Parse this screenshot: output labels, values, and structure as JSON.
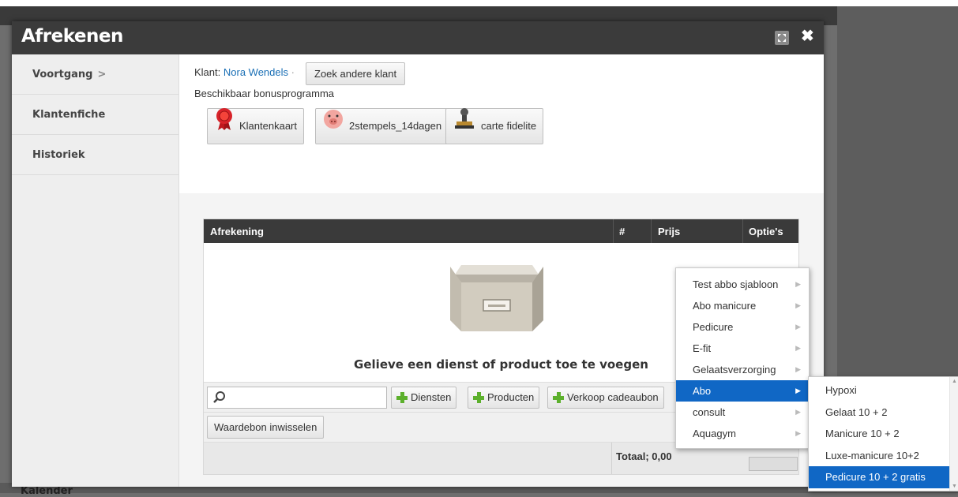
{
  "background": {
    "bottom_label": "Kalender"
  },
  "modal": {
    "title": "Afrekenen"
  },
  "sidebar": {
    "items": [
      {
        "label": "Voortgang",
        "suffix": ">"
      },
      {
        "label": "Klantenfiche"
      },
      {
        "label": "Historiek"
      }
    ]
  },
  "client": {
    "prefix": "Klant:",
    "name": "Nora Wendels",
    "separator": "·",
    "search_button": "Zoek andere klant",
    "bonus_label": "Beschikbaar bonusprogramma",
    "bonus_buttons": [
      {
        "label": "Klantenkaart",
        "icon": "red-rosette-icon"
      },
      {
        "label": "2stempels_14dagen",
        "icon": "piggy-bank-icon"
      },
      {
        "label": "carte fidelite",
        "icon": "stamp-icon"
      }
    ]
  },
  "table": {
    "headers": [
      "Afrekening",
      "#",
      "Prijs",
      "Optie's"
    ],
    "empty_message": "Gelieve een dienst of product toe te voegen",
    "search_value": "",
    "buttons": [
      "Diensten",
      "Producten",
      "Verkoop cadeaubon"
    ],
    "redeem_button": "Waardebon inwisselen",
    "total": "Totaal; 0,00"
  },
  "menu": {
    "items": [
      "Test abbo sjabloon",
      "Abo manicure",
      "Pedicure",
      "E-fit",
      "Gelaatsverzorging",
      "Abo",
      "consult",
      "Aquagym"
    ],
    "selected": "Abo"
  },
  "submenu": {
    "items": [
      "Hypoxi",
      "Gelaat 10 + 2",
      "Manicure 10 + 2",
      "Luxe-manicure 10+2",
      "Pedicure 10 + 2 gratis"
    ],
    "selected": "Pedicure 10 + 2 gratis"
  },
  "colors": {
    "accent": "#1067c5",
    "link": "#1a6fb5",
    "titlebar": "#3b3b3b",
    "plus": "#5cb02c"
  }
}
